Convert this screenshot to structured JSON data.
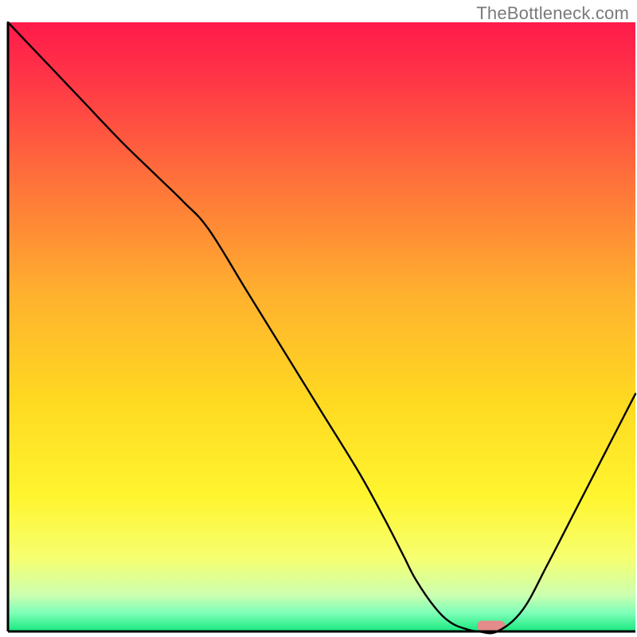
{
  "watermark": "TheBottleneck.com",
  "chart_data": {
    "type": "line",
    "title": "",
    "xlabel": "",
    "ylabel": "",
    "xlim": [
      0,
      100
    ],
    "ylim": [
      0,
      100
    ],
    "legend": "none",
    "grid": false,
    "background_gradient": {
      "stops": [
        {
          "offset": 0.0,
          "color": "#ff1a4b"
        },
        {
          "offset": 0.1,
          "color": "#ff3846"
        },
        {
          "offset": 0.25,
          "color": "#ff6e3b"
        },
        {
          "offset": 0.45,
          "color": "#ffb22e"
        },
        {
          "offset": 0.62,
          "color": "#ffd921"
        },
        {
          "offset": 0.78,
          "color": "#fff52f"
        },
        {
          "offset": 0.88,
          "color": "#f6ff70"
        },
        {
          "offset": 0.94,
          "color": "#ccffb0"
        },
        {
          "offset": 0.97,
          "color": "#7dffb8"
        },
        {
          "offset": 1.0,
          "color": "#17e87e"
        }
      ]
    },
    "series": [
      {
        "name": "bottleneck-curve",
        "color": "#000000",
        "x": [
          0.0,
          6.0,
          12.0,
          18.0,
          24.0,
          28.0,
          32.0,
          38.0,
          44.0,
          50.0,
          56.0,
          60.0,
          63.0,
          65.0,
          68.0,
          70.5,
          73.0,
          75.0,
          78.0,
          82.0,
          86.0,
          90.0,
          94.0,
          98.0,
          100.0
        ],
        "values": [
          100.0,
          93.5,
          87.0,
          80.5,
          74.5,
          70.5,
          66.0,
          56.0,
          46.0,
          36.0,
          26.0,
          18.5,
          12.5,
          8.5,
          4.0,
          1.5,
          0.4,
          0.0,
          0.0,
          3.5,
          11.0,
          19.0,
          27.0,
          35.0,
          39.0
        ]
      }
    ],
    "marker": {
      "name": "optimal-range-marker",
      "x_center": 77.0,
      "width": 4.5,
      "color": "#e48b8b"
    },
    "axes": {
      "color": "#000000",
      "left": true,
      "bottom": true,
      "top": false,
      "right": false
    }
  }
}
